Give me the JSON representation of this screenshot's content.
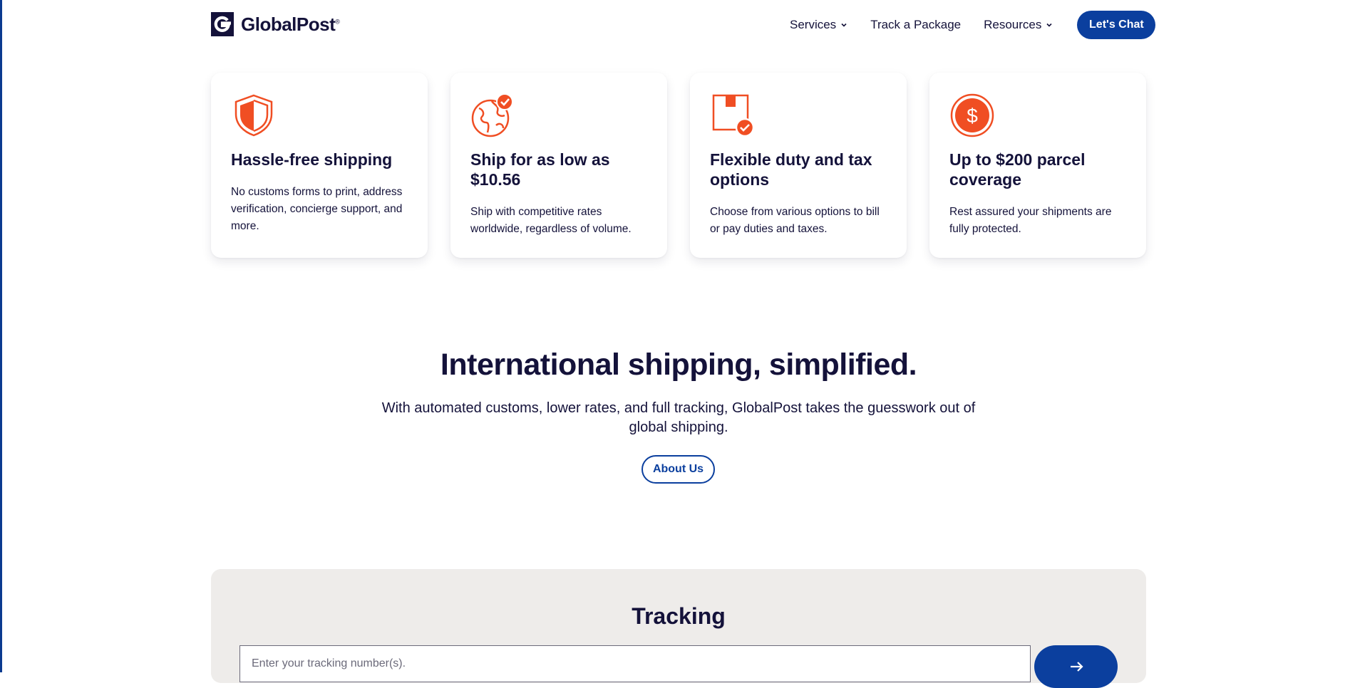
{
  "brand": {
    "name": "GlobalPost",
    "trademark": "®",
    "colors": {
      "navy": "#14123a",
      "accent": "#f04e23",
      "primary": "#0b3f9e",
      "panel": "#eeecea"
    }
  },
  "nav": {
    "items": [
      {
        "label": "Services",
        "icon": "chevron-down-icon"
      },
      {
        "label": "Track a Package"
      },
      {
        "label": "Resources",
        "icon": "chevron-down-icon"
      }
    ],
    "cta": "Let's Chat"
  },
  "features": [
    {
      "icon": "shield-icon",
      "title": "Hassle-free shipping",
      "description": "No customs forms to print, address verification, concierge support, and more."
    },
    {
      "icon": "globe-check-icon",
      "title": "Ship for as low as $10.56",
      "description": "Ship with competitive rates worldwide, regardless of volume."
    },
    {
      "icon": "box-check-icon",
      "title": "Flexible duty and tax options",
      "description": "Choose from various options to bill or pay duties and taxes."
    },
    {
      "icon": "dollar-coin-icon",
      "title": "Up to $200 parcel coverage",
      "description": "Rest assured your shipments are fully protected."
    }
  ],
  "hero": {
    "headline": "International shipping, simplified.",
    "subtext": "With automated customs, lower rates, and full tracking, GlobalPost takes the guesswork out of global shipping.",
    "button": "About Us"
  },
  "tracking": {
    "title": "Tracking",
    "placeholder": "Enter your tracking number(s).",
    "value": "",
    "submit_icon": "arrow-right-icon"
  }
}
